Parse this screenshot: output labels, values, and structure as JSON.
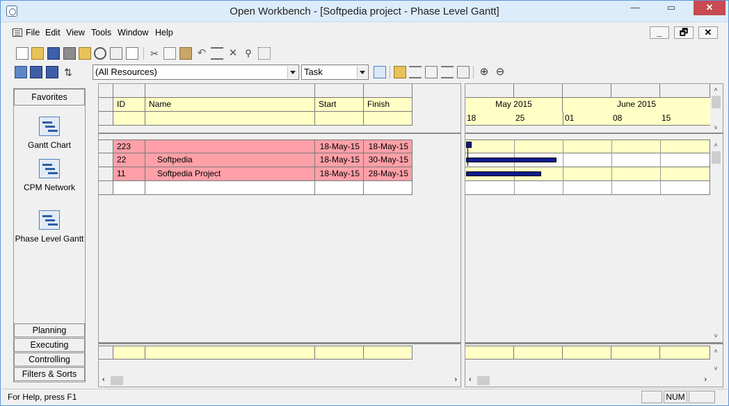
{
  "window": {
    "title": "Open Workbench - [Softpedia project - Phase Level Gantt]",
    "min": "—",
    "max": "▭",
    "close": "✕"
  },
  "menu": {
    "file": "File",
    "edit": "Edit",
    "view": "View",
    "tools": "Tools",
    "window": "Window",
    "help": "Help"
  },
  "mdi": {
    "min": "_",
    "restore": "🗗",
    "close": "✕"
  },
  "filters": {
    "resources": "(All Resources)",
    "type": "Task"
  },
  "sidebar": {
    "header": "Favorites",
    "items": [
      {
        "label": "Gantt Chart"
      },
      {
        "label": "CPM Network"
      },
      {
        "label": "Phase Level Gantt"
      }
    ],
    "buttons": [
      "Planning",
      "Executing",
      "Controlling",
      "Filters & Sorts"
    ]
  },
  "table": {
    "columns": [
      "ID",
      "Name",
      "Start",
      "Finish"
    ],
    "rows": [
      {
        "id": "223",
        "name": "",
        "start": "18-May-15",
        "finish": "18-May-15"
      },
      {
        "id": "22",
        "name": "Softpedia",
        "start": "18-May-15",
        "finish": "30-May-15"
      },
      {
        "id": "11",
        "name": "Softpedia Project",
        "start": "18-May-15",
        "finish": "28-May-15"
      }
    ]
  },
  "timeline": {
    "months": [
      "May 2015",
      "June 2015"
    ],
    "days": [
      "18",
      "25",
      "01",
      "08",
      "15"
    ]
  },
  "gantt_bars": [
    {
      "start_day": 0,
      "length_days": 0.5,
      "kind": "milestone"
    },
    {
      "start_day": 0,
      "length_days": 12
    },
    {
      "start_day": 0,
      "length_days": 10
    }
  ],
  "status": {
    "help": "For Help, press F1",
    "num": "NUM"
  },
  "colors": {
    "row_highlight": "#ffa0a8",
    "header_bg": "#ffffc6",
    "bar": "#0b1a8e"
  }
}
